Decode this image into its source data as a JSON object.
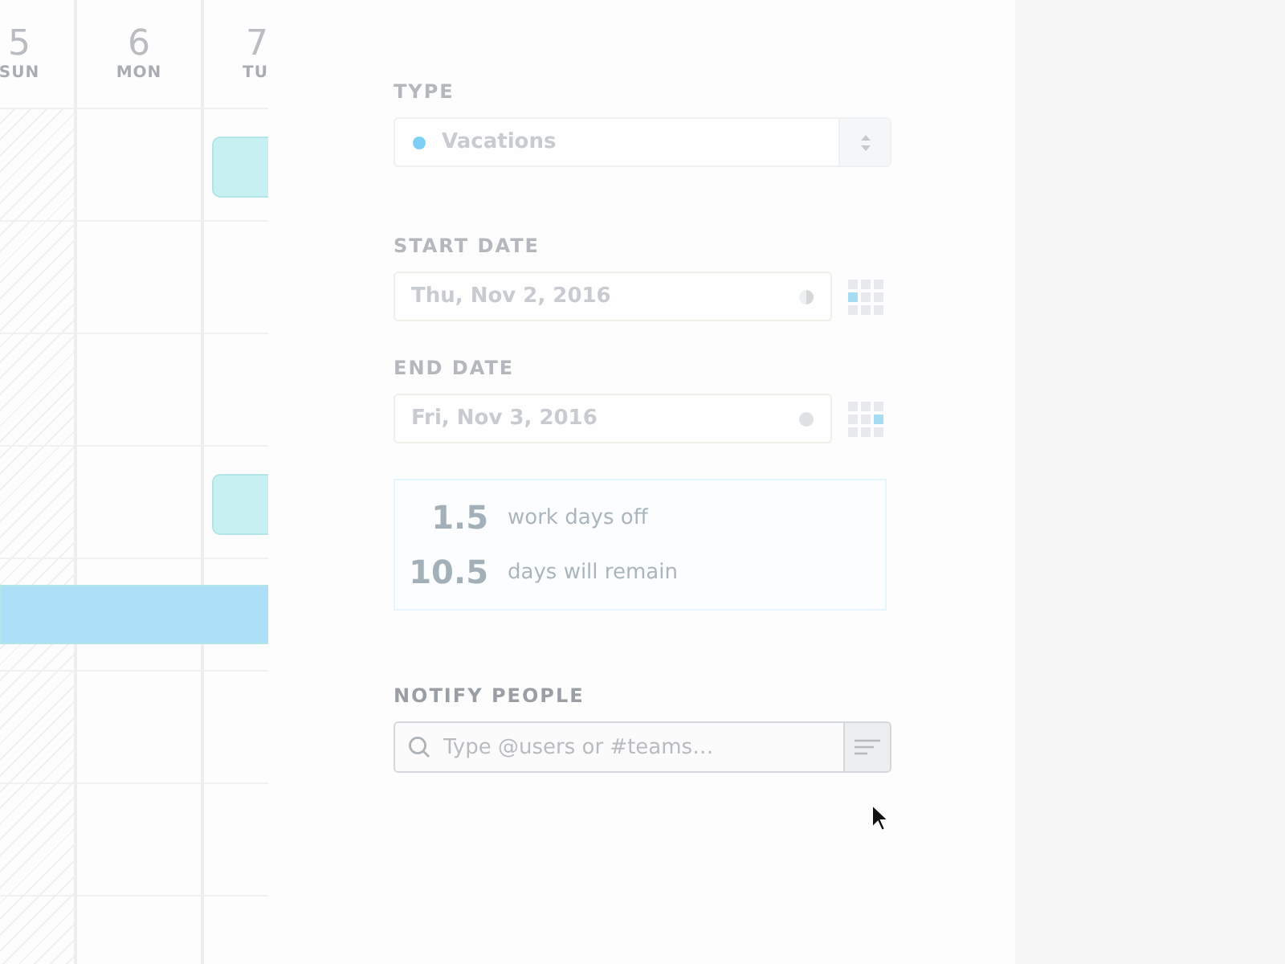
{
  "calendar": {
    "days": [
      {
        "number": "5",
        "weekday": "SUN",
        "weekend": true
      },
      {
        "number": "6",
        "weekday": "MON",
        "weekend": false
      },
      {
        "number": "7",
        "weekday": "TU",
        "weekend": false
      }
    ],
    "events": [
      {
        "color": "#c6f0f2"
      },
      {
        "color": "#c6f0f2"
      },
      {
        "color": "#aedff8"
      }
    ]
  },
  "form": {
    "type": {
      "label": "TYPE",
      "value": "Vacations",
      "color": "#7dd0f5"
    },
    "start_date": {
      "label": "START DATE",
      "value": "Thu, Nov 2, 2016"
    },
    "end_date": {
      "label": "END DATE",
      "value": "Fri, Nov 3, 2016"
    },
    "summary": [
      {
        "number": "1.5",
        "text": "work days off"
      },
      {
        "number": "10.5",
        "text": "days will remain"
      }
    ],
    "notify": {
      "label": "NOTIFY PEOPLE",
      "placeholder": "Type @users or #teams…"
    }
  }
}
